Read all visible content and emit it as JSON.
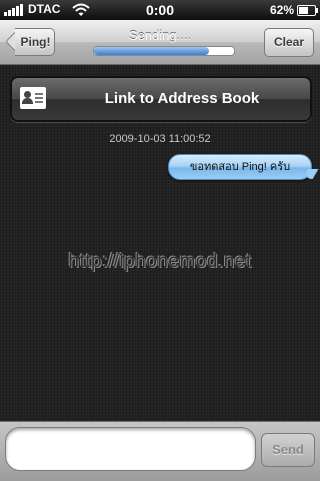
{
  "status_bar": {
    "carrier": "DTAC",
    "time": "0:00",
    "battery_percent": "62%",
    "battery_level": 0.62,
    "signal_bars": 5
  },
  "nav": {
    "back_label": "Ping!",
    "title": "Sending....",
    "progress": 0.82,
    "clear_label": "Clear"
  },
  "content": {
    "address_book_label": "Link to Address Book",
    "timestamp": "2009-10-03 11:00:52",
    "message": "ขอทดสอบ Ping! ครับ",
    "watermark": "http://iphonemod.net"
  },
  "input_bar": {
    "message_value": "",
    "send_label": "Send"
  },
  "colors": {
    "accent_progress": "#3d7fd3",
    "bubble": "#9ccdf2"
  }
}
